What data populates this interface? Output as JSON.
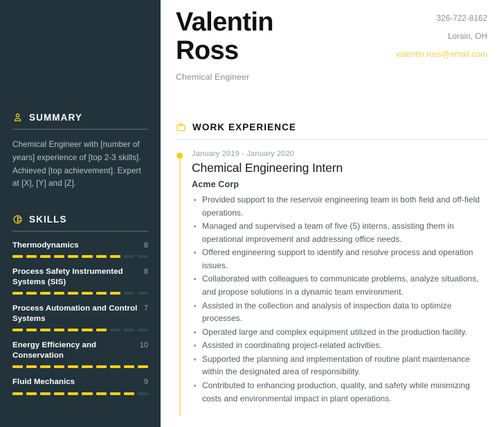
{
  "colors": {
    "sidebar_bg": "#22333b",
    "accent": "#f5d013",
    "email": "#f0cf4a",
    "muted": "#8a8f93"
  },
  "header": {
    "first_name": "Valentin",
    "last_name": "Ross",
    "job_title": "Chemical Engineer",
    "contact": {
      "phone": "326-722-8162",
      "location": "Lorain, OH",
      "email": "valentin.ross@email.com"
    }
  },
  "sidebar": {
    "summary": {
      "icon": "user-icon",
      "title": "SUMMARY",
      "text": "Chemical Engineer with [number of years] experience of [top 2-3 skills]. Achieved [top achievement]. Expert at [X], [Y] and [Z]."
    },
    "skills": {
      "icon": "skill-gauge-icon",
      "title": "SKILLS",
      "max": 10,
      "items": [
        {
          "name": "Thermodynamics",
          "score": 8
        },
        {
          "name": "Process Safety Instrumented Systems (SIS)",
          "score": 8
        },
        {
          "name": "Process Automation and Control Systems",
          "score": 7
        },
        {
          "name": "Energy Efficiency and Conservation",
          "score": 10
        },
        {
          "name": "Fluid Mechanics",
          "score": 9
        }
      ]
    }
  },
  "main": {
    "work_experience": {
      "icon": "briefcase-icon",
      "title": "WORK EXPERIENCE",
      "entries": [
        {
          "date": "January 2019 - January 2020",
          "role": "Chemical Engineering Intern",
          "company": "Acme Corp",
          "bullets": [
            "Provided support to the reservoir engineering team in both field and off-field operations.",
            "Managed and supervised a team of five (5) interns, assisting them in operational improvement and addressing office needs.",
            "Offered engineering support to identify and resolve process and operation issues.",
            "Collaborated with colleagues to communicate problems, analyze situations, and propose solutions in a dynamic team environment.",
            "Assisted in the collection and analysis of inspection data to optimize processes.",
            "Operated large and complex equipment utilized in the production facility.",
            "Assisted in coordinating project-related activities.",
            "Supported the planning and implementation of routine plant maintenance within the designated area of responsibility.",
            "Contributed to enhancing production, quality, and safety while minimizing costs and environmental impact in plant operations."
          ]
        }
      ]
    }
  }
}
